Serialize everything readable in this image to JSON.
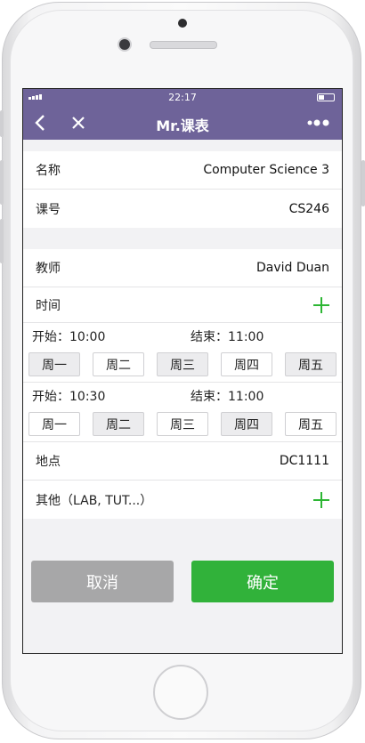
{
  "status": {
    "time": "22:17"
  },
  "nav": {
    "title": "Mr.课表"
  },
  "course": {
    "name_label": "名称",
    "name_value": "Computer Science 3",
    "code_label": "课号",
    "code_value": "CS246"
  },
  "details": {
    "teacher_label": "教师",
    "teacher_value": "David Duan",
    "time_label": "时间",
    "slots": [
      {
        "start": "开始：10:00",
        "end": "结束：11:00",
        "days": [
          "周一",
          "周二",
          "周三",
          "周四",
          "周五"
        ],
        "selected": [
          true,
          false,
          true,
          false,
          true
        ]
      },
      {
        "start": "开始：10:30",
        "end": "结束：11:00",
        "days": [
          "周一",
          "周二",
          "周三",
          "周四",
          "周五"
        ],
        "selected": [
          false,
          true,
          false,
          true,
          false
        ]
      }
    ],
    "location_label": "地点",
    "location_value": "DC1111",
    "other_label": "其他（LAB, TUT...）"
  },
  "actions": {
    "cancel": "取消",
    "confirm": "确定"
  },
  "colors": {
    "nav": "#6e6399",
    "confirm": "#31b23a",
    "cancel": "#a7a7a8",
    "plus": "#2db634"
  }
}
